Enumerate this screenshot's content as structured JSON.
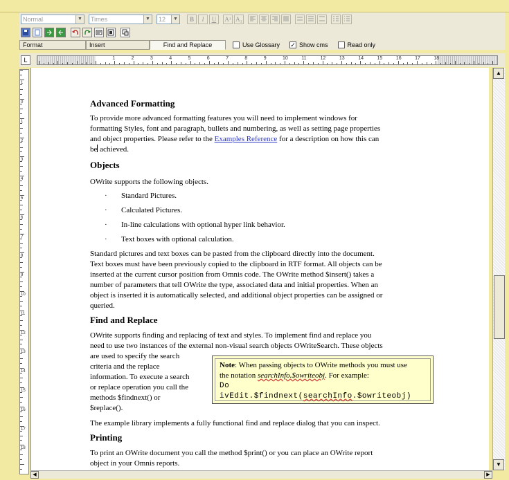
{
  "toolbar": {
    "style_combo": "Normal",
    "font_combo": "Times",
    "size_combo": "12",
    "bold": "B",
    "italic": "I",
    "underline": "U",
    "superscript": "A¹",
    "subscript": "A₁"
  },
  "tabs": [
    "Format",
    "Insert",
    "Find and Replace"
  ],
  "options": {
    "use_glossary": "Use Glossary",
    "use_glossary_checked": false,
    "show_cms": "Show cms",
    "show_cms_checked": true,
    "read_only": "Read only",
    "read_only_checked": false
  },
  "ruler": {
    "corner": "L",
    "numbers": [
      "1",
      "2",
      "3",
      "4",
      "5",
      "6",
      "7",
      "8",
      "9",
      "10",
      "11",
      "12",
      "13",
      "14",
      "15",
      "16",
      "17",
      "18"
    ]
  },
  "vruler": {
    "numbers": [
      "11",
      "10",
      "9",
      "8",
      "7",
      "6",
      "5",
      "4",
      "3",
      "2",
      "1",
      "0",
      "1",
      "2",
      "3",
      "4",
      "5",
      "6",
      "7",
      "8",
      "9",
      "10",
      "11",
      "12",
      "13",
      "14",
      "15",
      "16",
      "17",
      "18"
    ]
  },
  "doc": {
    "h_advanced": "Advanced Formatting",
    "p_advanced_1": "To provide more advanced formatting features you will need to implement windows for",
    "p_advanced_2": "formatting Styles, font and paragraph, bullets and numbering, as well as setting page properties",
    "p_advanced_3a": "and object properties. Please refer to the ",
    "p_advanced_link": "Examples Reference",
    "p_advanced_3b": " for a description on how this can",
    "p_advanced_4a": "be",
    "p_advanced_4b": " achieved.",
    "h_objects": "Objects",
    "p_objects": "OWrite supports the following objects.",
    "bullet_char": "·",
    "bullets": [
      "Standard Pictures.",
      "Calculated Pictures.",
      "In-line calculations with optional hyper link behavior.",
      "Text boxes with optional calculation."
    ],
    "p_std_1": "Standard pictures and text boxes can be pasted from the clipboard directly into the document.",
    "p_std_2": "Text boxes must have been previously copied to the clipboard in RTF format. All objects can be",
    "p_std_3": "inserted at the current cursor position from Omnis code. The OWrite method $insert() takes a",
    "p_std_4": "number of parameters that tell OWrite the type, associated data and initial properties. When an",
    "p_std_5": "object is inserted it is automatically selected, and additional object properties can be assigned or",
    "p_std_6": "queried.",
    "h_find": "Find and Replace",
    "p_find_1": "OWrite supports finding and replacing of text and styles. To implement find and replace you",
    "p_find_2": "need to use two instances of the external non-visual search objects OWriteSearch. These objects",
    "p_find_3": "are used to specify the search",
    "p_find_4": "criteria and the replace",
    "p_find_5": "information. To execute a search",
    "p_find_6": "or replace operation you call the",
    "p_find_7": "methods $findnext() or",
    "p_find_8": "$replace().",
    "note_label": "Note",
    "note_1": ": When passing objects to OWrite methods you must use",
    "note_2a": "the notation ",
    "note_2b": "searchInfo.$owriteobj",
    "note_2c": ". For example:",
    "note_code_a": "Do ivEdit.$findnext(",
    "note_code_b": "searchInfo",
    "note_code_c": ".$owriteobj)",
    "p_example": "The example library implements a fully functional find and replace dialog that you can inspect.",
    "h_printing": "Printing",
    "p_print_1": "To print an OWrite document you call the method $print() or you can place an OWrite report",
    "p_print_2": "object in your Omnis reports."
  }
}
